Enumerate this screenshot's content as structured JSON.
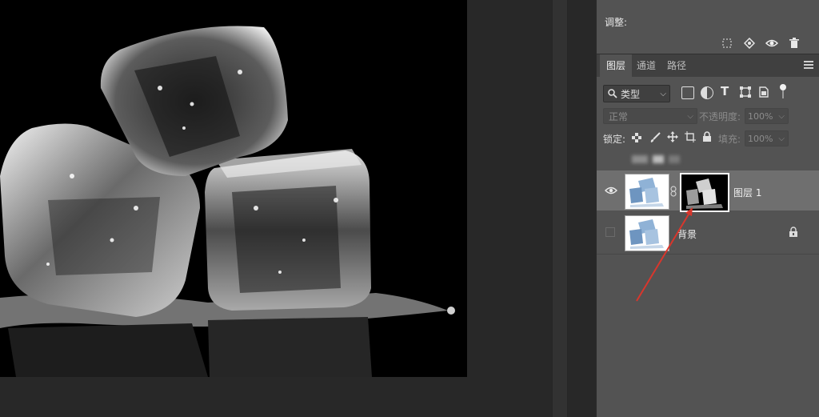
{
  "adjustments": {
    "label": "调整:"
  },
  "adjust_tools": {
    "icons": [
      "selection-marquee-icon",
      "mask-diamond-icon",
      "visibility-eye-icon",
      "trash-icon"
    ]
  },
  "tabs": [
    {
      "label": "图层",
      "active": true
    },
    {
      "label": "通道",
      "active": false
    },
    {
      "label": "路径",
      "active": false
    }
  ],
  "filter": {
    "kind_label": "类型"
  },
  "blend": {
    "mode": "正常",
    "opacity_label": "不透明度:",
    "opacity_value": "100%"
  },
  "lock": {
    "label": "锁定:",
    "fill_label": "填充:",
    "fill_value": "100%"
  },
  "layers": [
    {
      "name": "图层 1",
      "visible": true,
      "selected": true,
      "has_mask": true
    },
    {
      "name": "背景",
      "visible": false,
      "selected": false,
      "locked": true
    }
  ],
  "colors": {
    "panel": "#535353",
    "selected_row": "#6f6f6f",
    "canvas_bg": "#000000",
    "arrow": "#d9362c"
  }
}
